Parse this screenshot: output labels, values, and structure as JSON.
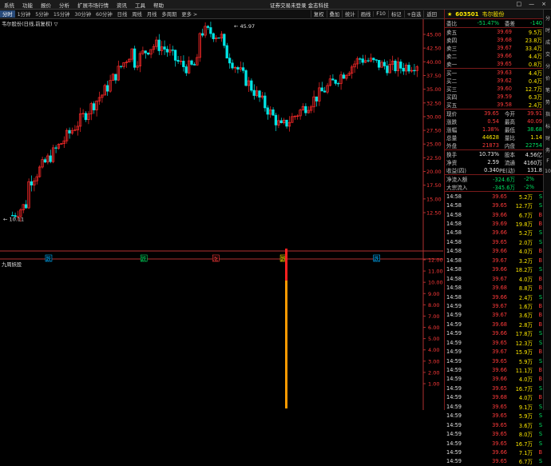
{
  "menubar": {
    "items": [
      "系统",
      "功能",
      "报价",
      "分析",
      "扩展市场行情",
      "资讯",
      "工具",
      "帮助"
    ],
    "app_title": "证券交易未登录  金志科技",
    "win_controls": [
      "□",
      "—",
      "×"
    ]
  },
  "periodbar": {
    "items": [
      "分时",
      "1分钟",
      "5分钟",
      "15分钟",
      "30分钟",
      "60分钟",
      "日线",
      "周线",
      "月线",
      "多周期",
      "更多 >"
    ],
    "active_index": 0,
    "tools": [
      "复权",
      "叠加",
      "统计",
      "画线",
      "F10",
      "标记",
      "+自选",
      "返回"
    ]
  },
  "chart": {
    "title": "韦尔股份(日线,前复权) ▽",
    "high_marker": "45.97",
    "low_marker": "10.11",
    "y_ticks": [
      "45.00",
      "42.50",
      "40.00",
      "37.50",
      "35.00",
      "32.50",
      "30.00",
      "27.50",
      "25.00",
      "22.50",
      "20.00",
      "17.50",
      "15.00",
      "12.50"
    ],
    "ind_title": "九周妖股",
    "ind_ticks": [
      "12.00",
      "11.00",
      "10.00",
      "9.00",
      "8.00",
      "7.00",
      "6.00",
      "5.00",
      "4.00",
      "3.00",
      "2.00",
      "1.00"
    ],
    "markers": [
      {
        "label": "跌",
        "color": "#00b0ff",
        "x": 0.115
      },
      {
        "label": "跌",
        "color": "#00e060",
        "x": 0.34
      },
      {
        "label": "涨",
        "color": "#ff3a3a",
        "x": 0.51
      },
      {
        "label": "跌",
        "color": "#ffea00",
        "x": 0.67
      },
      {
        "label": "跌",
        "color": "#00b0ff",
        "x": 0.89
      }
    ],
    "colors": {
      "up": "#ff2a2a",
      "down": "#00e5e5",
      "axis": "#b03030",
      "ind_top": "#ff2020",
      "ind_bar": "#ff9a00"
    }
  },
  "quote": {
    "code": "603501",
    "name": "韦尔股份",
    "header_row": {
      "label1": "委比",
      "val1": "-51.47%",
      "label2": "委差",
      "val2": "-140"
    },
    "asks": [
      {
        "label": "卖五",
        "price": "39.69",
        "vol": "9.5万"
      },
      {
        "label": "卖四",
        "price": "39.68",
        "vol": "23.8万"
      },
      {
        "label": "卖三",
        "price": "39.67",
        "vol": "33.4万"
      },
      {
        "label": "卖二",
        "price": "39.66",
        "vol": "4.4万"
      },
      {
        "label": "卖一",
        "price": "39.65",
        "vol": "0.8万"
      }
    ],
    "bids": [
      {
        "label": "买一",
        "price": "39.63",
        "vol": "4.4万"
      },
      {
        "label": "买二",
        "price": "39.62",
        "vol": "0.4万"
      },
      {
        "label": "买三",
        "price": "39.60",
        "vol": "12.7万"
      },
      {
        "label": "买四",
        "price": "39.59",
        "vol": "6.3万"
      },
      {
        "label": "买五",
        "price": "39.58",
        "vol": "2.4万"
      }
    ],
    "stats": [
      {
        "l1": "现价",
        "v1": "39.65",
        "l2": "今开",
        "v2": "39.91",
        "c1": "red",
        "c2": "red"
      },
      {
        "l1": "涨跌",
        "v1": "0.54",
        "l2": "最高",
        "v2": "40.09",
        "c1": "red",
        "c2": "red"
      },
      {
        "l1": "涨幅",
        "v1": "1.38%",
        "l2": "最低",
        "v2": "38.68",
        "c1": "red",
        "c2": "green"
      },
      {
        "l1": "总量",
        "v1": "44628",
        "l2": "量比",
        "v2": "1.14",
        "c1": "yellow",
        "c2": "yellow"
      },
      {
        "l1": "外盘",
        "v1": "21873",
        "l2": "内盘",
        "v2": "22754",
        "c1": "red",
        "c2": "green"
      }
    ],
    "stats2": [
      {
        "l1": "换手",
        "v1": "10.73%",
        "l2": "股本",
        "v2": "4.56亿"
      },
      {
        "l1": "净资",
        "v1": "2.59",
        "l2": "流通",
        "v2": "4160万"
      },
      {
        "l1": "收益(四)",
        "v1": "0.340",
        "l2": "PE(动)",
        "v2": "131.8"
      }
    ],
    "flows": [
      {
        "label": "净流入额",
        "val": "-324.6万",
        "pct": "-2%"
      },
      {
        "label": "大宗流入",
        "val": "-345.6万",
        "pct": "-2%"
      }
    ],
    "ticks": [
      {
        "t": "14:58",
        "p": "39.65",
        "v": "5.2万",
        "d": "S"
      },
      {
        "t": "14:58",
        "p": "39.65",
        "v": "12.7万",
        "d": "S"
      },
      {
        "t": "14:58",
        "p": "39.66",
        "v": "6.7万",
        "d": "B"
      },
      {
        "t": "14:58",
        "p": "39.69",
        "v": "19.8万",
        "d": "B"
      },
      {
        "t": "14:58",
        "p": "39.66",
        "v": "5.2万",
        "d": "S"
      },
      {
        "t": "14:58",
        "p": "39.65",
        "v": "2.0万",
        "d": "S"
      },
      {
        "t": "14:58",
        "p": "39.66",
        "v": "4.0万",
        "d": "B"
      },
      {
        "t": "14:58",
        "p": "39.67",
        "v": "3.2万",
        "d": "B"
      },
      {
        "t": "14:58",
        "p": "39.66",
        "v": "18.2万",
        "d": "S"
      },
      {
        "t": "14:58",
        "p": "39.67",
        "v": "4.0万",
        "d": "B"
      },
      {
        "t": "14:58",
        "p": "39.68",
        "v": "8.8万",
        "d": "B"
      },
      {
        "t": "14:58",
        "p": "39.66",
        "v": "2.4万",
        "d": "S"
      },
      {
        "t": "14:59",
        "p": "39.67",
        "v": "1.6万",
        "d": "B"
      },
      {
        "t": "14:59",
        "p": "39.67",
        "v": "3.6万",
        "d": "B"
      },
      {
        "t": "14:59",
        "p": "39.68",
        "v": "2.8万",
        "d": "B"
      },
      {
        "t": "14:59",
        "p": "39.66",
        "v": "17.8万",
        "d": "S"
      },
      {
        "t": "14:59",
        "p": "39.65",
        "v": "12.3万",
        "d": "S"
      },
      {
        "t": "14:59",
        "p": "39.67",
        "v": "15.9万",
        "d": "B"
      },
      {
        "t": "14:59",
        "p": "39.65",
        "v": "5.9万",
        "d": "S"
      },
      {
        "t": "14:59",
        "p": "39.66",
        "v": "11.1万",
        "d": "B"
      },
      {
        "t": "14:59",
        "p": "39.66",
        "v": "4.0万",
        "d": "B"
      },
      {
        "t": "14:59",
        "p": "39.65",
        "v": "16.7万",
        "d": "S"
      },
      {
        "t": "14:59",
        "p": "39.68",
        "v": "4.0万",
        "d": "B"
      },
      {
        "t": "14:59",
        "p": "39.65",
        "v": "9.1万",
        "d": "S"
      },
      {
        "t": "14:59",
        "p": "39.65",
        "v": "5.9万",
        "d": "S"
      },
      {
        "t": "14:59",
        "p": "39.65",
        "v": "3.6万",
        "d": "S"
      },
      {
        "t": "14:59",
        "p": "39.65",
        "v": "8.0万",
        "d": "S"
      },
      {
        "t": "14:59",
        "p": "39.65",
        "v": "16.7万",
        "d": "S"
      },
      {
        "t": "14:59",
        "p": "39.66",
        "v": "7.1万",
        "d": "B"
      },
      {
        "t": "14:59",
        "p": "39.65",
        "v": "6.7万",
        "d": "S"
      }
    ]
  },
  "scrollbar": {
    "items": [
      "分",
      "时",
      "成",
      "交",
      "分",
      "价",
      "笔",
      "势",
      "指",
      "标",
      "财",
      "务",
      "F",
      "10"
    ]
  }
}
